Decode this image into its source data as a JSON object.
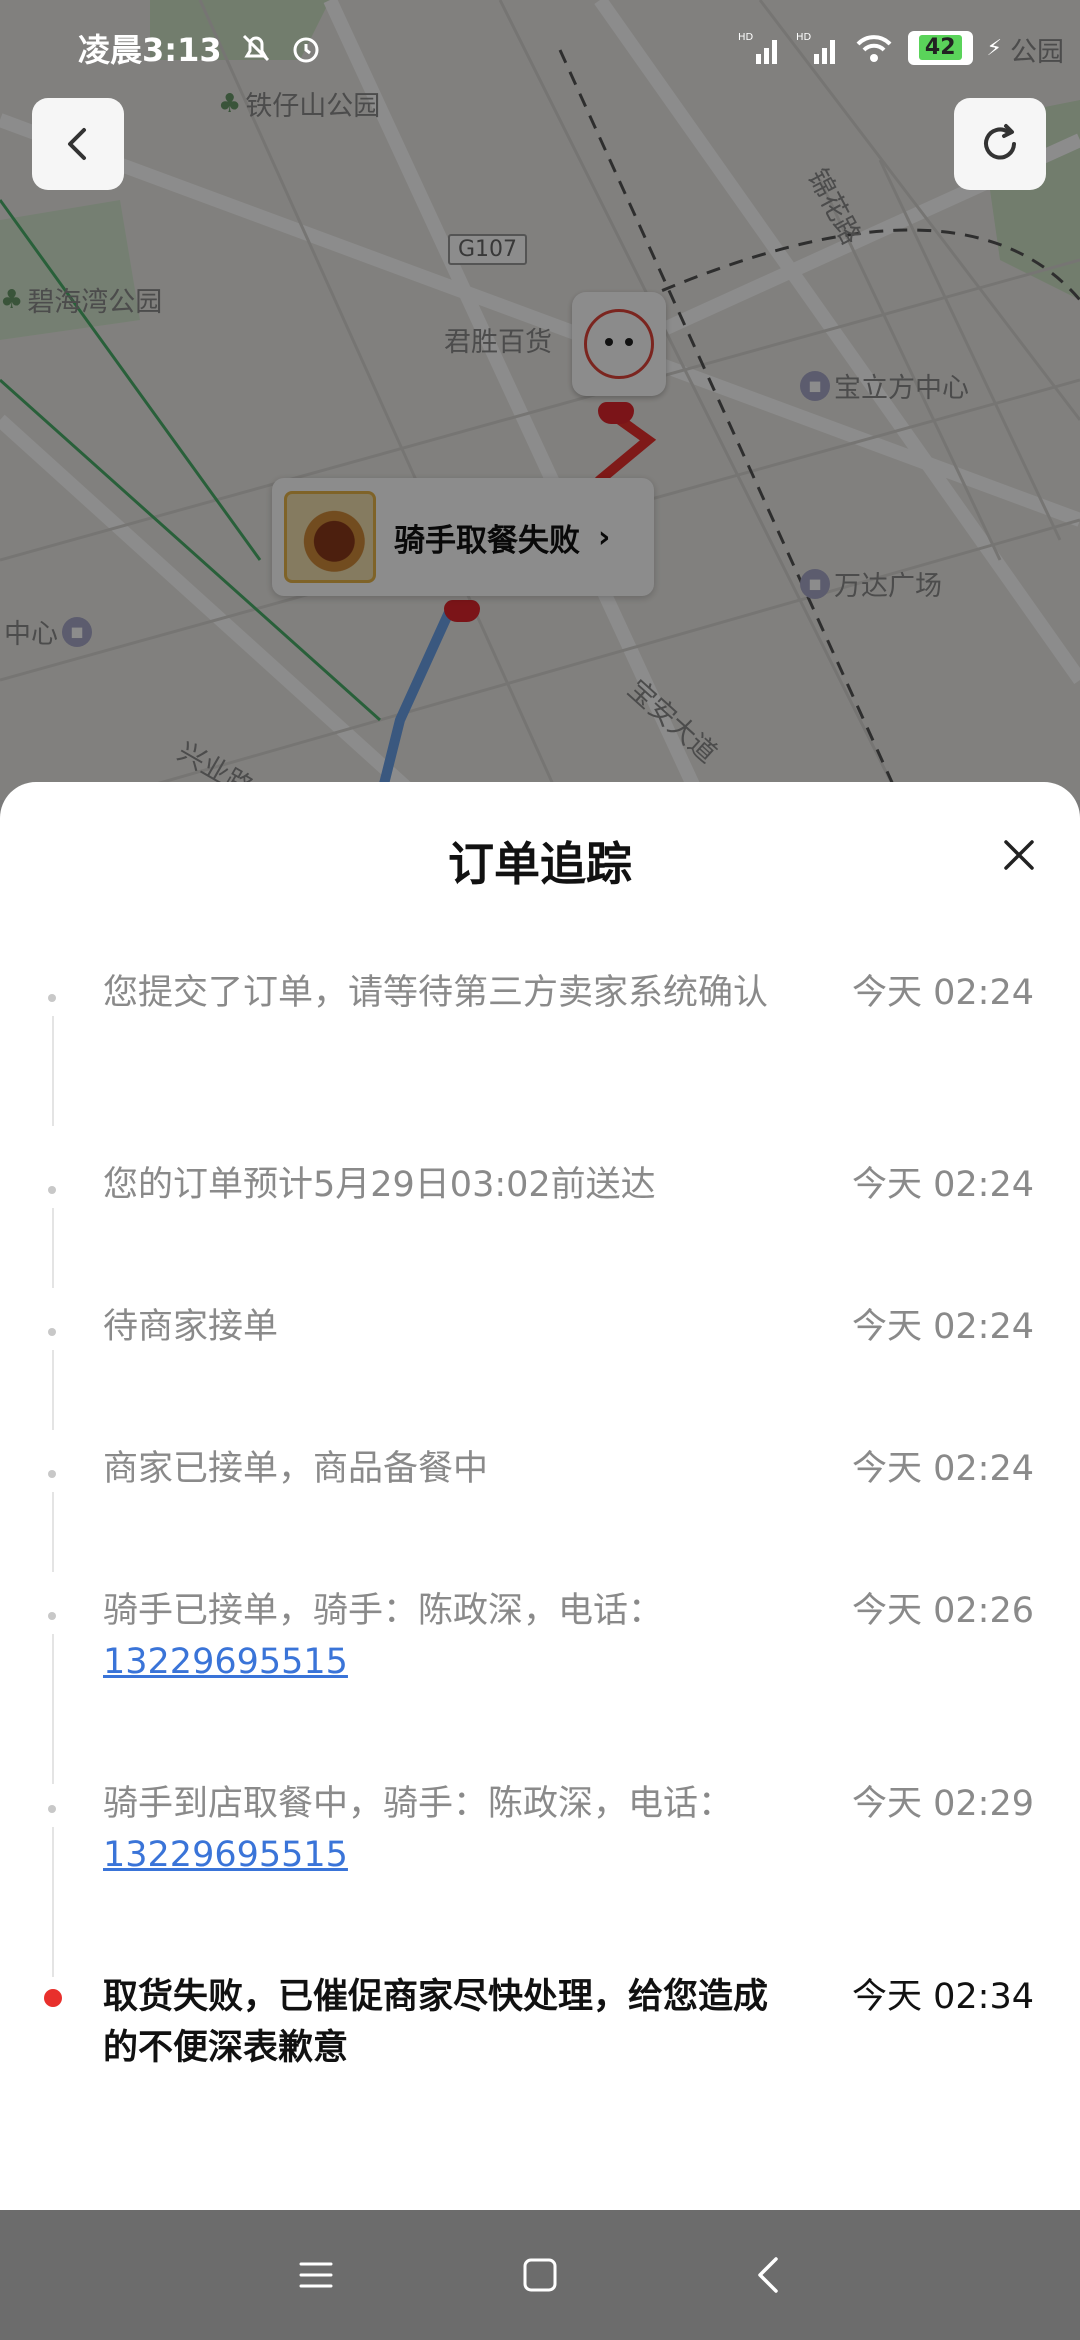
{
  "status_bar": {
    "time": "凌晨3:13",
    "battery": "42",
    "network": "HD"
  },
  "map": {
    "pois": [
      "铁仔山公园",
      "碧海湾公园",
      "君胜百货",
      "宝立方中心",
      "万达广场",
      "中心",
      "公园"
    ],
    "roads": [
      "锦花路",
      "宝安大道",
      "兴业路"
    ],
    "highway": "G107",
    "store_card_label": "骑手取餐失败"
  },
  "sheet": {
    "title": "订单追踪",
    "events": [
      {
        "text": "您提交了订单，请等待第三方卖家系统确认",
        "time": "今天 02:24",
        "phone": ""
      },
      {
        "text": "您的订单预计5月29日03:02前送达",
        "time": "今天 02:24",
        "phone": ""
      },
      {
        "text": "待商家接单",
        "time": "今天 02:24",
        "phone": ""
      },
      {
        "text": "商家已接单，商品备餐中",
        "time": "今天 02:24",
        "phone": ""
      },
      {
        "text": "骑手已接单，骑手：陈政深，电话：",
        "time": "今天 02:26",
        "phone": "13229695515"
      },
      {
        "text": "骑手到店取餐中，骑手：陈政深，电话：",
        "time": "今天 02:29",
        "phone": "13229695515"
      },
      {
        "text": "取货失败，已催促商家尽快处理，给您造成的不便深表歉意",
        "time": "今天 02:34",
        "phone": ""
      }
    ]
  },
  "colors": {
    "accent_red": "#e8302c",
    "link_blue": "#3a74d8"
  }
}
